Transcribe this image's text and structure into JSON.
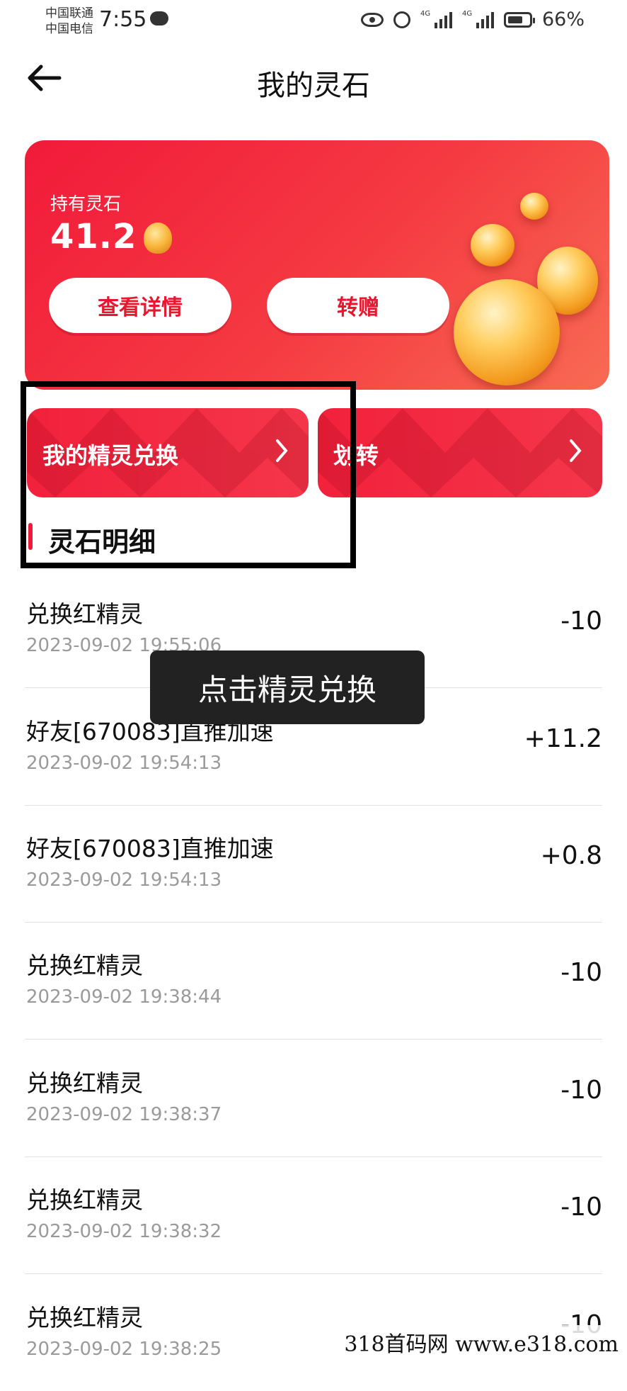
{
  "status_bar": {
    "carrier1": "中国联通",
    "carrier2": "中国电信",
    "time": "7:55",
    "battery": "66%"
  },
  "header": {
    "title": "我的灵石"
  },
  "card": {
    "label": "持有灵石",
    "amount": "41.2",
    "detail_button": "查看详情",
    "gift_button": "转赠"
  },
  "actions": {
    "exchange": "我的精灵兑换",
    "transfer": "划转"
  },
  "section": {
    "title": "灵石明细"
  },
  "records": [
    {
      "title": "兑换红精灵",
      "time": "2023-09-02 19:55:06",
      "amount": "-10"
    },
    {
      "title": "好友[670083]直推加速",
      "time": "2023-09-02 19:54:13",
      "amount": "+11.2"
    },
    {
      "title": "好友[670083]直推加速",
      "time": "2023-09-02 19:54:13",
      "amount": "+0.8"
    },
    {
      "title": "兑换红精灵",
      "time": "2023-09-02 19:38:44",
      "amount": "-10"
    },
    {
      "title": "兑换红精灵",
      "time": "2023-09-02 19:38:37",
      "amount": "-10"
    },
    {
      "title": "兑换红精灵",
      "time": "2023-09-02 19:38:32",
      "amount": "-10"
    },
    {
      "title": "兑换红精灵",
      "time": "2023-09-02 19:38:25",
      "amount": "-10"
    }
  ],
  "toast": "点击精灵兑换",
  "watermark": "318首码网 www.e318.com",
  "colors": {
    "accent": "#f11a3a",
    "card_end": "#f86b54"
  }
}
